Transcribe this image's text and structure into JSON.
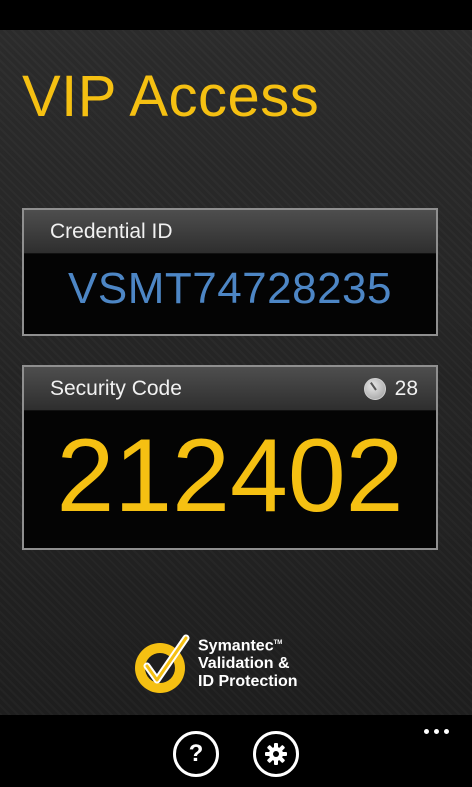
{
  "app": {
    "title": "VIP Access"
  },
  "credential": {
    "label": "Credential ID",
    "value": "VSMT74728235"
  },
  "security": {
    "label": "Security Code",
    "seconds_remaining": "28",
    "code": "212402"
  },
  "logo": {
    "line1": "Symantec",
    "trademark": "TM",
    "line2": "Validation &",
    "line3": "ID Protection"
  },
  "appbar": {
    "buttons": [
      "help-icon",
      "gear-icon",
      "more-icon"
    ]
  },
  "colors": {
    "accent": "#f5c012",
    "credential_text": "#4d86c5",
    "background": "#1a1a1a"
  }
}
